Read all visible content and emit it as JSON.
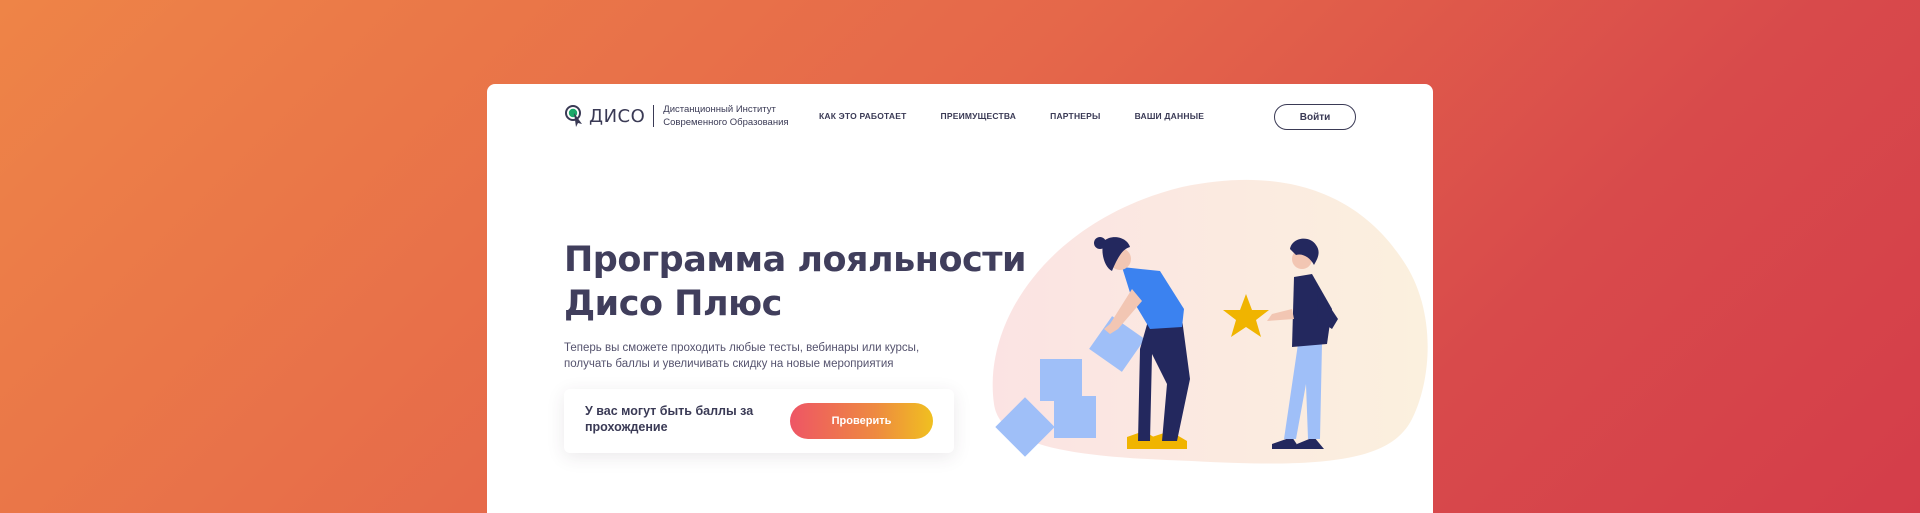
{
  "header": {
    "logo_name": "ДИСО",
    "logo_desc_line1": "Дистанционный Институт",
    "logo_desc_line2": "Современного Образования",
    "nav": [
      {
        "label": "КАК ЭТО РАБОТАЕТ"
      },
      {
        "label": "ПРЕИМУЩЕСТВА"
      },
      {
        "label": "ПАРТНЕРЫ"
      },
      {
        "label": "ВАШИ ДАННЫЕ"
      }
    ],
    "login_label": "Войти"
  },
  "hero": {
    "title_line1": "Программа лояльности",
    "title_line2": "Дисо Плюс",
    "subtitle_line1": "Теперь вы сможете проходить любые тесты, вебинары или курсы,",
    "subtitle_line2": "получать баллы и увеличивать скидку на новые мероприятия"
  },
  "check": {
    "text": "У вас могут быть баллы за прохождение",
    "button_label": "Проверить"
  },
  "colors": {
    "brand_text": "#3a3a55",
    "accent_start": "#ee5565",
    "accent_end": "#f0c020",
    "figure_blue": "#3b82f0",
    "figure_navy": "#23285e",
    "star_yellow": "#f0b400"
  },
  "icons": {
    "logo": "pin-cursor-icon",
    "illustration": "people-with-star-and-blocks"
  }
}
